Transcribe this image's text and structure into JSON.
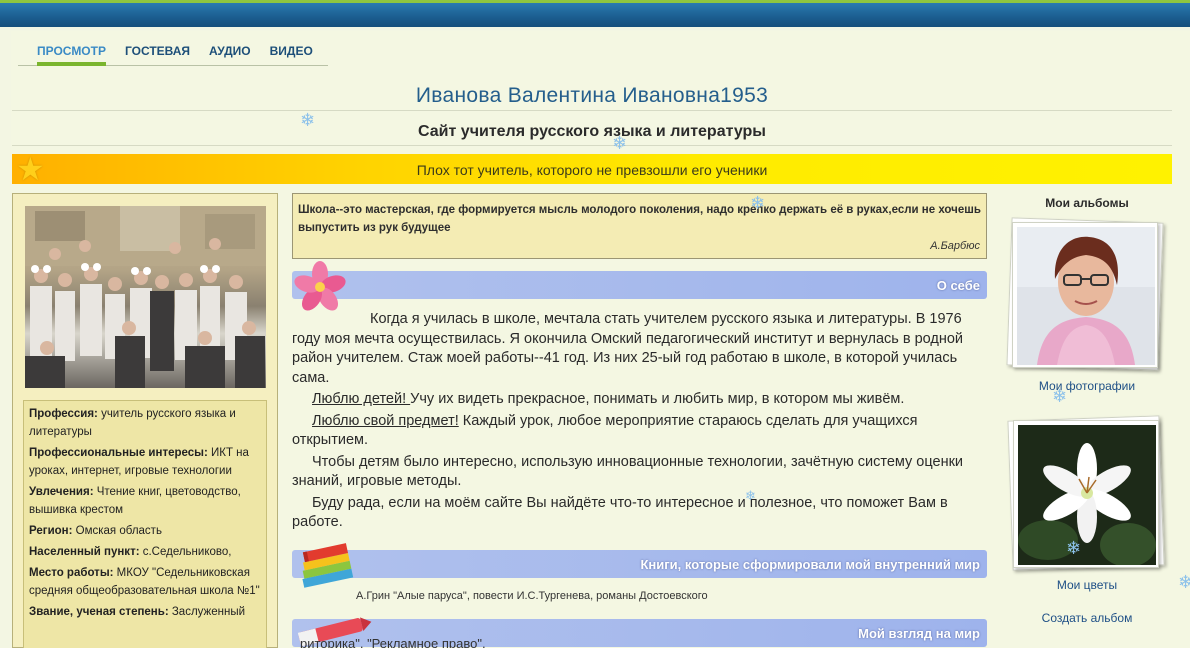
{
  "nav": {
    "items": [
      "ПРОСМОТР",
      "ГОСТЕВАЯ",
      "АУДИО",
      "ВИДЕО"
    ]
  },
  "header": {
    "title": "Иванова Валентина Ивановна1953",
    "subtitle": "Сайт учителя русского языка и литературы",
    "banner": "Плох тот учитель, которого не превзошли его ученики"
  },
  "profile": {
    "rows": [
      {
        "label": "Профессия:",
        "value": " учитель русского языка и литературы"
      },
      {
        "label": "Профессиональные интересы:",
        "value": " ИКТ на уроках, интернет, игровые технологии"
      },
      {
        "label": "Увлечения:",
        "value": " Чтение книг, цветоводство, вышивка крестом"
      },
      {
        "label": "Регион:",
        "value": " Омская область"
      },
      {
        "label": "Населенный пункт:",
        "value": " с.Седельниково,"
      },
      {
        "label": "Место работы:",
        "value": " МКОУ \"Седельниковская средняя общеобразовательная школа №1\""
      },
      {
        "label": "Звание, ученая степень:",
        "value": " Заслуженный"
      }
    ]
  },
  "quote": {
    "text": "Школа--это мастерская, где формируется мысль молодого поколения, надо крепко держать её в руках,если не хочешь выпустить из рук будущее",
    "author": "А.Барбюс"
  },
  "sections": {
    "about": "О себе",
    "books": "Книги, которые сформировали мой внутренний мир",
    "view": "Мой взгляд на мир"
  },
  "about": {
    "p1": "Когда я училась в школе, мечтала стать учителем русского языка и литературы. В 1976 году моя мечта осуществилась. Я окончила Омский педагогический институт и вернулась в родной район учителем. Стаж моей работы--41 год. Из них 25-ый год работаю в школе, в которой училась сама.",
    "p2_link": "Люблю детей! ",
    "p2_text": " Учу их видеть прекрасное, понимать и любить мир, в котором мы живём.",
    "p3_link": "Люблю свой предмет!",
    "p3_text": "  Каждый урок, любое мероприятие стараюсь сделать для учащихся открытием.",
    "p4": "Чтобы детям было интересно, использую инновационные технологии, зачётную систему оценки знаний, игровые методы.",
    "p5": "Буду рада, если на моём сайте Вы найдёте что-то интересное и полезное, что поможет Вам в работе."
  },
  "books_text": "А.Грин \"Алые паруса\",  повести И.С.Тургенева, романы Достоевского",
  "cut_text": "риторика\", \"Рекламное право\",",
  "albums": {
    "title": "Мои альбомы",
    "photos_label": "Мои фотографии",
    "flowers_label": "Мои цветы",
    "create_label": "Создать альбом"
  },
  "colors": {
    "accent": "#245e8c",
    "section_bar": "#9eb3ec",
    "banner": "#ffeb00",
    "nav_active": "#7ab52e"
  }
}
